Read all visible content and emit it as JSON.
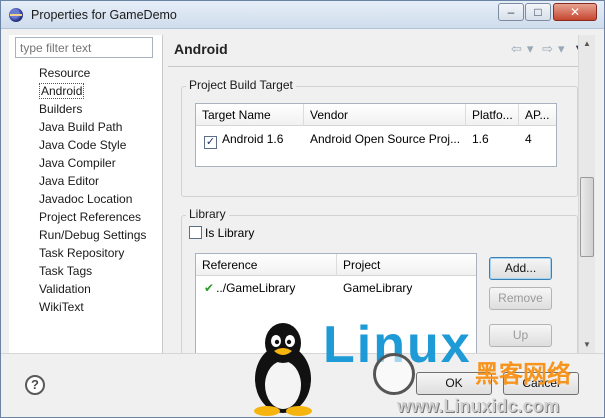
{
  "window": {
    "title": "Properties for GameDemo"
  },
  "titlebar": {
    "min": "–",
    "max": "□",
    "close": "✕"
  },
  "filter": {
    "placeholder": "type filter text"
  },
  "tree": {
    "items": [
      {
        "label": "Resource"
      },
      {
        "label": "Android",
        "selected": true
      },
      {
        "label": "Builders"
      },
      {
        "label": "Java Build Path"
      },
      {
        "label": "Java Code Style"
      },
      {
        "label": "Java Compiler"
      },
      {
        "label": "Java Editor"
      },
      {
        "label": "Javadoc Location"
      },
      {
        "label": "Project References"
      },
      {
        "label": "Run/Debug Settings"
      },
      {
        "label": "Task Repository"
      },
      {
        "label": "Task Tags"
      },
      {
        "label": "Validation"
      },
      {
        "label": "WikiText"
      }
    ]
  },
  "page": {
    "title": "Android"
  },
  "nav": {
    "back": "⇦",
    "back_menu": "▾",
    "forward": "⇨",
    "forward_menu": "▾",
    "view_menu": "▼"
  },
  "build_target": {
    "title": "Project Build Target",
    "columns": [
      "Target Name",
      "Vendor",
      "Platfo...",
      "AP..."
    ],
    "rows": [
      {
        "checked": true,
        "check_mark": "✓",
        "name": "Android 1.6",
        "vendor": "Android Open Source Proj...",
        "platform": "1.6",
        "api": "4"
      }
    ]
  },
  "library": {
    "title": "Library",
    "is_library_label": "Is Library",
    "is_library_checked": false,
    "columns": [
      "Reference",
      "Project"
    ],
    "rows": [
      {
        "status_icon": "check-icon",
        "status_glyph": "✔",
        "reference": "../GameLibrary",
        "project": "GameLibrary"
      }
    ],
    "buttons": {
      "add": "Add...",
      "remove": "Remove",
      "up": "Up"
    }
  },
  "footer": {
    "help": "?",
    "ok": "OK",
    "cancel": "Cancel"
  },
  "watermark": {
    "logo_text": "Linux",
    "cn_text": "黑客网络",
    "url": "www.Linuxidc.com"
  },
  "colors": {
    "accent": "#1e9ad6",
    "check_green": "#2d9b27",
    "watermark_orange": "#f7941d"
  }
}
